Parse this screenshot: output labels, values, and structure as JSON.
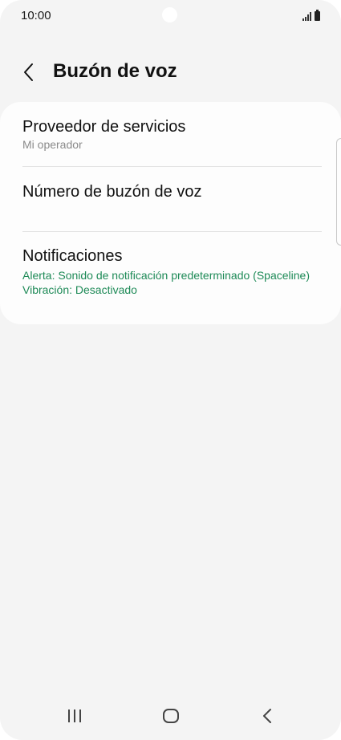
{
  "status_bar": {
    "time": "10:00",
    "icons": [
      "signal-icon",
      "battery-icon"
    ]
  },
  "header": {
    "back_icon": "chevron-left-icon",
    "title": "Buzón de voz"
  },
  "settings": {
    "provider": {
      "title": "Proveedor de servicios",
      "subtitle": "Mi operador"
    },
    "voicemail_number": {
      "title": "Número de buzón de voz"
    },
    "notifications": {
      "title": "Notificaciones",
      "alert_line": "Alerta: Sonido de notificación predeterminado (Spaceline)",
      "vibration_line": "Vibración: Desactivado"
    }
  },
  "nav_bar": {
    "icons": [
      "recent-apps-icon",
      "home-icon",
      "back-icon"
    ]
  },
  "colors": {
    "background": "#f4f4f4",
    "card": "#fdfdfd",
    "accent_green": "#1e8a57",
    "secondary_text": "#8a8a8a"
  }
}
